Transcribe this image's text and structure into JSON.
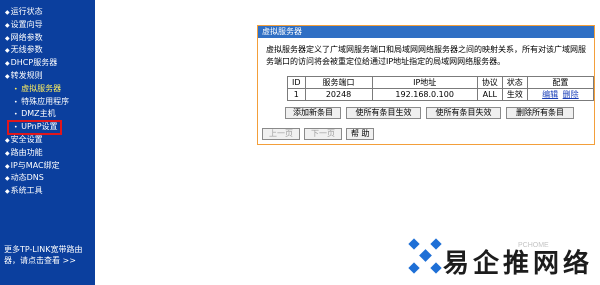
{
  "sidebar": {
    "items": [
      {
        "label": "运行状态"
      },
      {
        "label": "设置向导"
      },
      {
        "label": "网络参数"
      },
      {
        "label": "无线参数"
      },
      {
        "label": "DHCP服务器"
      },
      {
        "label": "转发规则"
      },
      {
        "label": "虚拟服务器"
      },
      {
        "label": "特殊应用程序"
      },
      {
        "label": "DMZ主机"
      },
      {
        "label": "UPnP设置"
      },
      {
        "label": "安全设置"
      },
      {
        "label": "路由功能"
      },
      {
        "label": "IP与MAC绑定"
      },
      {
        "label": "动态DNS"
      },
      {
        "label": "系统工具"
      }
    ],
    "footer_line1": "更多TP-LINK宽带路由",
    "footer_line2": "器，请点击查看 >>"
  },
  "panel": {
    "title": "虚拟服务器",
    "description": "虚拟服务器定义了广域网服务端口和局域网网络服务器之间的映射关系，所有对该广域网服务端口的访问将会被重定位给通过IP地址指定的局域网网络服务器。",
    "table": {
      "headers": [
        "ID",
        "服务端口",
        "IP地址",
        "协议",
        "状态",
        "配置"
      ],
      "rows": [
        {
          "id": "1",
          "port": "20248",
          "ip": "192.168.0.100",
          "protocol": "ALL",
          "status": "生效",
          "edit": "编辑",
          "delete": "删除"
        }
      ]
    },
    "buttons": {
      "add": "添加新条目",
      "enable_all": "使所有条目生效",
      "disable_all": "使所有条目失效",
      "delete_all": "删除所有条目",
      "prev": "上一页",
      "next": "下一页",
      "help": "帮 助"
    }
  },
  "brand": {
    "text": "易企推网络",
    "watermark": "PCHOME"
  },
  "colors": {
    "sidebar_bg": "#0b3f9e",
    "panel_title_bg": "#2f6fc4",
    "panel_border": "#f39f3a",
    "active_item": "#ffef5e",
    "highlight_box": "#e0161c",
    "logo_blue": "#1e6fd6"
  }
}
